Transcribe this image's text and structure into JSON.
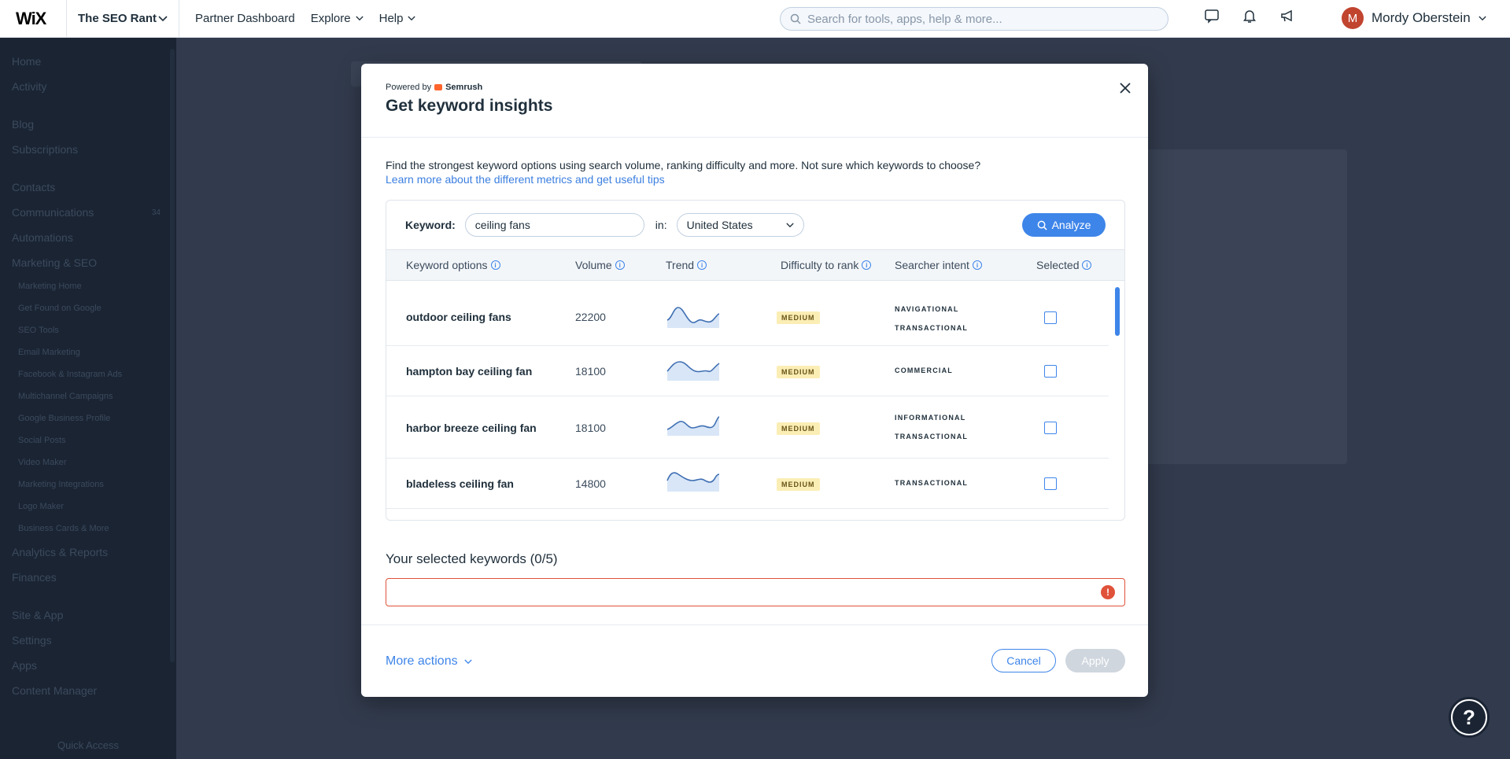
{
  "topbar": {
    "logo": "WiX",
    "site_name": "The SEO Rant",
    "nav": [
      "Partner Dashboard",
      "Explore",
      "Help"
    ],
    "search_placeholder": "Search for tools, apps, help & more...",
    "user_name": "Mordy Oberstein",
    "user_initial": "M"
  },
  "sidebar": {
    "items": [
      "Home",
      "Activity",
      "Blog",
      "Subscriptions",
      "Contacts",
      "Communications",
      "Automations",
      "Marketing & SEO"
    ],
    "communications_count": "34",
    "subitems": [
      "Marketing Home",
      "Get Found on Google",
      "SEO Tools",
      "Email Marketing",
      "Facebook & Instagram Ads",
      "Multichannel Campaigns",
      "Google Business Profile",
      "Social Posts",
      "Video Maker",
      "Marketing Integrations",
      "Logo Maker",
      "Business Cards & More"
    ],
    "bottom_items": [
      "Analytics & Reports",
      "Finances",
      "Site & App",
      "Settings",
      "Apps",
      "Content Manager"
    ],
    "quick_access": "Quick Access"
  },
  "modal": {
    "powered_prefix": "Powered by",
    "powered_brand": "Semrush",
    "title": "Get keyword insights",
    "intro": "Find the strongest keyword options using search volume, ranking difficulty and more. Not sure which keywords to choose?",
    "intro_link": "Learn more about the different metrics and get useful tips",
    "keyword_label": "Keyword:",
    "keyword_value": "ceiling fans",
    "in_label": "in:",
    "country": "United States",
    "analyze_label": "Analyze",
    "columns": {
      "keyword": "Keyword options",
      "volume": "Volume",
      "trend": "Trend",
      "difficulty": "Difficulty to rank",
      "intent": "Searcher intent",
      "selected": "Selected"
    },
    "rows": [
      {
        "keyword": "outdoor ceiling fans",
        "volume": "22200",
        "difficulty": "MEDIUM",
        "intent": [
          "NAVIGATIONAL",
          "TRANSACTIONAL"
        ]
      },
      {
        "keyword": "hampton bay ceiling fan",
        "volume": "18100",
        "difficulty": "MEDIUM",
        "intent": [
          "COMMERCIAL"
        ]
      },
      {
        "keyword": "harbor breeze ceiling fan",
        "volume": "18100",
        "difficulty": "MEDIUM",
        "intent": [
          "INFORMATIONAL",
          "TRANSACTIONAL"
        ]
      },
      {
        "keyword": "bladeless ceiling fan",
        "volume": "14800",
        "difficulty": "MEDIUM",
        "intent": [
          "TRANSACTIONAL"
        ]
      }
    ],
    "selected_title": "Your selected keywords (0/5)",
    "more_actions": "More actions",
    "cancel_label": "Cancel",
    "apply_label": "Apply"
  },
  "colors": {
    "accent": "#3e85e9",
    "sidebar_bg": "#1a2433",
    "badge_bg": "#fbeeb5",
    "error": "#e0523a"
  }
}
